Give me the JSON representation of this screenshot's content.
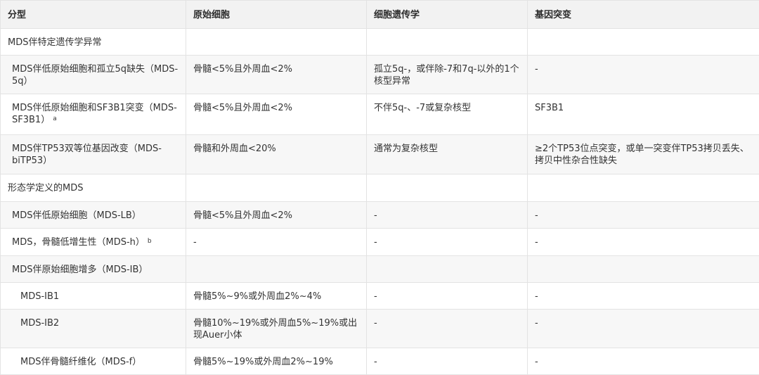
{
  "headers": [
    "分型",
    "原始细胞",
    "细胞遗传学",
    "基因突变"
  ],
  "rows": [
    {
      "c1": "MDS伴特定遗传学异常",
      "sup": "",
      "c2": "",
      "c3": "",
      "c4": ""
    },
    {
      "c1": "MDS伴低原始细胞和孤立5q缺失（MDS-5q）",
      "sup": "",
      "c2": "骨髓<5%且外周血<2%",
      "c3": "孤立5q-，或伴除-7和7q-以外的1个核型异常",
      "c4": "-"
    },
    {
      "c1": "MDS伴低原始细胞和SF3B1突变（MDS-SF3B1）",
      "sup": "a",
      "c2": "骨髓<5%且外周血<2%",
      "c3": "不伴5q-、-7或复杂核型",
      "c4": "SF3B1"
    },
    {
      "c1": "MDS伴TP53双等位基因改变（MDS-biTP53）",
      "sup": "",
      "c2": "骨髓和外周血<20%",
      "c3": "通常为复杂核型",
      "c4": "≥2个TP53位点突变，或单一突变伴TP53拷贝丢失、拷贝中性杂合性缺失"
    },
    {
      "c1": "形态学定义的MDS",
      "sup": "",
      "c2": "",
      "c3": "",
      "c4": ""
    },
    {
      "c1": "MDS伴低原始细胞（MDS-LB）",
      "sup": "",
      "c2": "骨髓<5%且外周血<2%",
      "c3": "-",
      "c4": "-"
    },
    {
      "c1": "MDS，骨髓低增生性（MDS-h）",
      "sup": "b",
      "c2": "-",
      "c3": "-",
      "c4": "-"
    },
    {
      "c1": "MDS伴原始细胞增多（MDS-IB）",
      "sup": "",
      "c2": "",
      "c3": "",
      "c4": ""
    },
    {
      "c1": "MDS-IB1",
      "sup": "",
      "c2": "骨髓5%~9%或外周血2%~4%",
      "c3": "-",
      "c4": "-"
    },
    {
      "c1": "MDS-IB2",
      "sup": "",
      "c2": "骨髓10%~19%或外周血5%~19%或出现Auer小体",
      "c3": "-",
      "c4": "-"
    },
    {
      "c1": "MDS伴骨髓纤维化（MDS-f）",
      "sup": "",
      "c2": "骨髓5%~19%或外周血2%~19%",
      "c3": "-",
      "c4": "-"
    }
  ]
}
